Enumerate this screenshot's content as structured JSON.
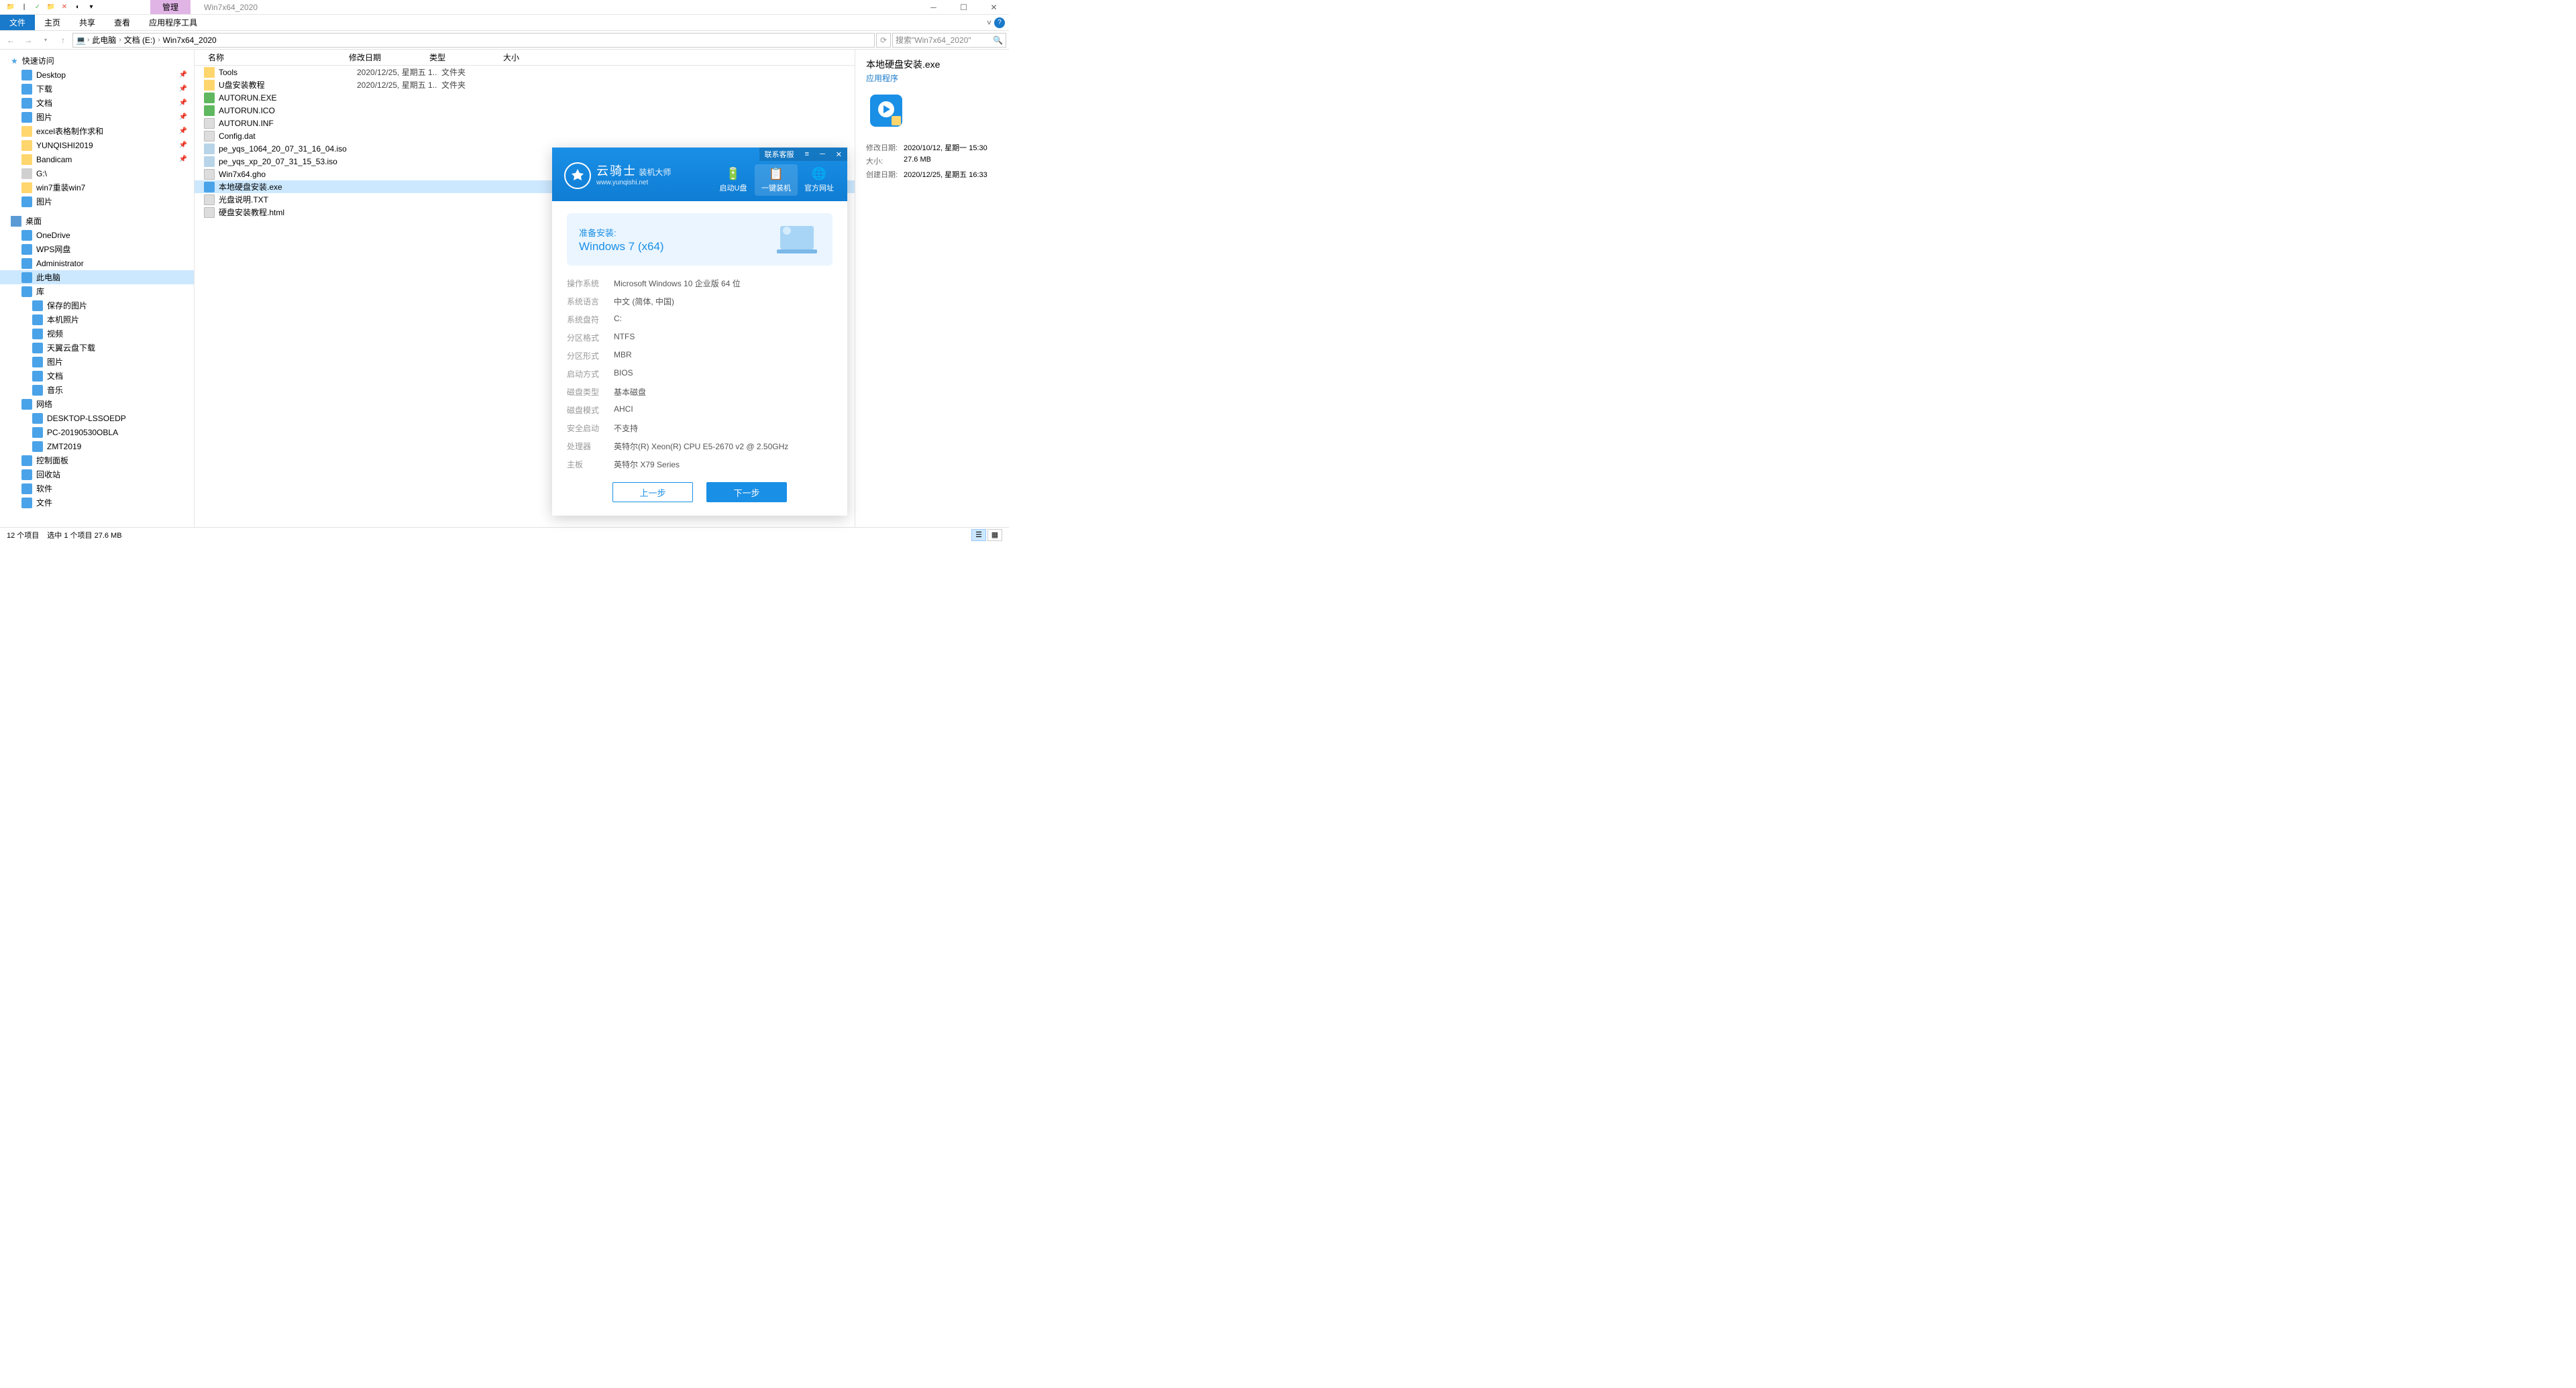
{
  "titlebar": {
    "manage_tab": "管理",
    "window_title": "Win7x64_2020"
  },
  "ribbon": {
    "file": "文件",
    "home": "主页",
    "share": "共享",
    "view": "查看",
    "app_tools": "应用程序工具"
  },
  "breadcrumb": {
    "this_pc": "此电脑",
    "docs": "文档 (E:)",
    "folder": "Win7x64_2020"
  },
  "search": {
    "placeholder": "搜索\"Win7x64_2020\""
  },
  "sidebar": {
    "quick": "快速访问",
    "quick_items": [
      "Desktop",
      "下载",
      "文档",
      "图片",
      "excel表格制作求和",
      "YUNQISHI2019",
      "Bandicam",
      "G:\\",
      "win7重装win7",
      "图片"
    ],
    "desktop": "桌面",
    "desktop_items": [
      "OneDrive",
      "WPS网盘",
      "Administrator",
      "此电脑",
      "库",
      "保存的图片",
      "本机照片",
      "视频",
      "天翼云盘下载",
      "图片",
      "文档",
      "音乐",
      "网络",
      "DESKTOP-LSSOEDP",
      "PC-20190530OBLA",
      "ZMT2019",
      "控制面板",
      "回收站",
      "软件",
      "文件"
    ]
  },
  "columns": {
    "name": "名称",
    "date": "修改日期",
    "type": "类型",
    "size": "大小"
  },
  "files": [
    {
      "name": "Tools",
      "date": "2020/12/25, 星期五 1...",
      "type": "文件夹",
      "icon": "folder"
    },
    {
      "name": "U盘安装教程",
      "date": "2020/12/25, 星期五 1...",
      "type": "文件夹",
      "icon": "folder"
    },
    {
      "name": "AUTORUN.EXE",
      "date": "",
      "type": "",
      "icon": "green"
    },
    {
      "name": "AUTORUN.ICO",
      "date": "",
      "type": "",
      "icon": "green"
    },
    {
      "name": "AUTORUN.INF",
      "date": "",
      "type": "",
      "icon": "gray"
    },
    {
      "name": "Config.dat",
      "date": "",
      "type": "",
      "icon": "gray"
    },
    {
      "name": "pe_yqs_1064_20_07_31_16_04.iso",
      "date": "",
      "type": "",
      "icon": "disk"
    },
    {
      "name": "pe_yqs_xp_20_07_31_15_53.iso",
      "date": "",
      "type": "",
      "icon": "disk"
    },
    {
      "name": "Win7x64.gho",
      "date": "",
      "type": "",
      "icon": "gray"
    },
    {
      "name": "本地硬盘安装.exe",
      "date": "",
      "type": "",
      "icon": "blue",
      "selected": true
    },
    {
      "name": "光盘说明.TXT",
      "date": "",
      "type": "",
      "icon": "gray"
    },
    {
      "name": "硬盘安装教程.html",
      "date": "",
      "type": "",
      "icon": "gray"
    }
  ],
  "details": {
    "title": "本地硬盘安装.exe",
    "subtitle": "应用程序",
    "rows": [
      {
        "label": "修改日期:",
        "value": "2020/10/12, 星期一 15:30"
      },
      {
        "label": "大小:",
        "value": "27.6 MB"
      },
      {
        "label": "创建日期:",
        "value": "2020/12/25, 星期五 16:33"
      }
    ]
  },
  "statusbar": {
    "count": "12 个项目",
    "selected": "选中 1 个项目  27.6 MB"
  },
  "dialog": {
    "contact": "联系客服",
    "logo_zh": "云骑士",
    "logo_sub": "装机大师",
    "logo_en": "www.yunqishi.net",
    "nav": [
      {
        "icon": "🔋",
        "label": "启动U盘"
      },
      {
        "icon": "📋",
        "label": "一键装机",
        "active": true
      },
      {
        "icon": "🌐",
        "label": "官方网址"
      }
    ],
    "prep_label": "准备安装:",
    "prep_os": "Windows 7 (x64)",
    "info": [
      {
        "label": "操作系统",
        "value": "Microsoft Windows 10 企业版 64 位"
      },
      {
        "label": "系统语言",
        "value": "中文 (简体, 中国)"
      },
      {
        "label": "系统盘符",
        "value": "C:"
      },
      {
        "label": "分区格式",
        "value": "NTFS"
      },
      {
        "label": "分区形式",
        "value": "MBR"
      },
      {
        "label": "启动方式",
        "value": "BIOS"
      },
      {
        "label": "磁盘类型",
        "value": "基本磁盘"
      },
      {
        "label": "磁盘模式",
        "value": "AHCI"
      },
      {
        "label": "安全启动",
        "value": "不支持"
      },
      {
        "label": "处理器",
        "value": "英特尔(R) Xeon(R) CPU E5-2670 v2 @ 2.50GHz"
      },
      {
        "label": "主板",
        "value": "英特尔 X79 Series"
      }
    ],
    "btn_prev": "上一步",
    "btn_next": "下一步"
  }
}
